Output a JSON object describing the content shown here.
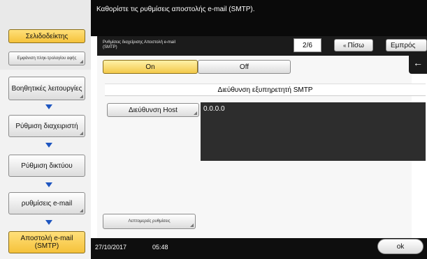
{
  "header": {
    "instruction": "Καθορίστε τις ρυθμίσεις αποστολής e-mail (SMTP)."
  },
  "sidebar": {
    "bookmark_label": "Σελιδοδείκτης",
    "item_small": "Εμφάνιση πληκ-τρολογίου αφής",
    "items": [
      {
        "label": "Βοηθητικές λειτουργίες"
      },
      {
        "label": "Ρύθμιση διαχειριστή"
      },
      {
        "label": "Ρύθμιση δικτύου"
      },
      {
        "label": "ρυθμίσεις e-mail"
      },
      {
        "label": "Αποστολή e-mail (SMTP)"
      }
    ]
  },
  "subheader": {
    "title": "Ρυθμίσεις διαχείρισης Αποστολή e-mail (SMTP)",
    "page": "2/6",
    "back_label": "Πίσω",
    "forward_label": "Εμπρός"
  },
  "toggle": {
    "on_label": "On",
    "off_label": "Off",
    "selected": "On"
  },
  "smtp": {
    "section_label": "Διεύθυνση εξυπηρετητή SMTP",
    "host_button": "Διεύθυνση Host",
    "host_value": "0.0.0.0"
  },
  "details_button": "Λεπτομερείς ρυθμίσεις",
  "status": {
    "date": "27/10/2017",
    "time": "05:48"
  },
  "ok_label": "ok",
  "colors": {
    "accent_yellow": "#f5c23a",
    "dark_bar": "#0a0a0a",
    "arrow_blue": "#1e56c0"
  }
}
